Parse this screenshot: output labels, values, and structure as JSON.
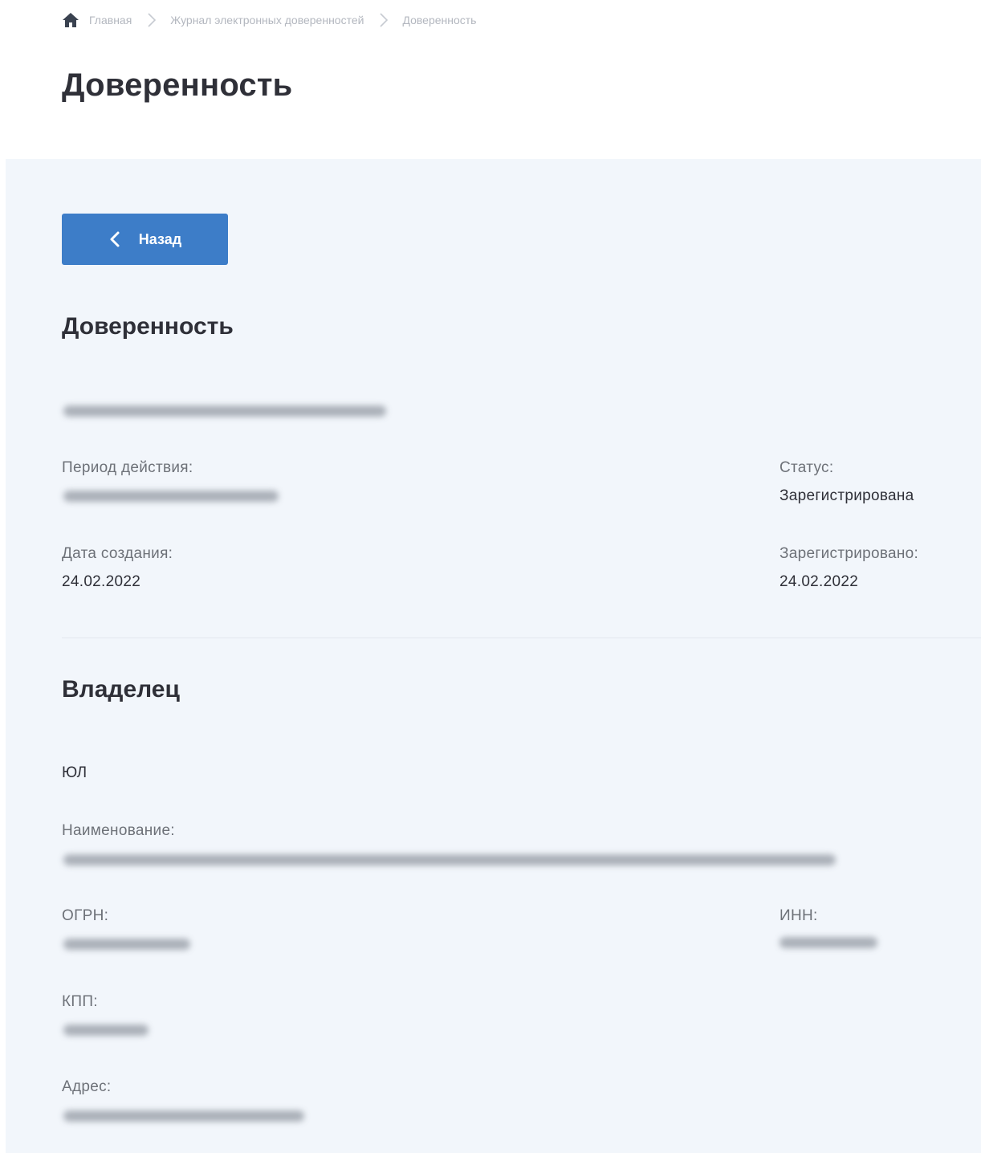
{
  "breadcrumb": {
    "home": "Главная",
    "journal": "Журнал электронных доверенностей",
    "current": "Доверенность"
  },
  "page": {
    "title": "Доверенность"
  },
  "back_button": {
    "label": "Назад"
  },
  "poa_section": {
    "title": "Доверенность",
    "period_label": "Период действия:",
    "status_label": "Статус:",
    "status_value": "Зарегистрирована",
    "created_label": "Дата создания:",
    "created_value": "24.02.2022",
    "registered_label": "Зарегистрировано:",
    "registered_value": "24.02.2022"
  },
  "owner_section": {
    "title": "Владелец",
    "type": "ЮЛ",
    "name_label": "Наименование:",
    "ogrn_label": "ОГРН:",
    "inn_label": "ИНН:",
    "kpp_label": "КПП:",
    "address_label": "Адрес:"
  },
  "colors": {
    "accent": "#3d7dc8",
    "panel_bg": "#f2f6fb",
    "title_text": "#2f3038",
    "label_text": "#6d7178",
    "breadcrumb_text": "#b3b7bf"
  },
  "icons": {
    "home": "home-icon",
    "separator": "chevron-right-icon",
    "back": "chevron-left-icon"
  }
}
